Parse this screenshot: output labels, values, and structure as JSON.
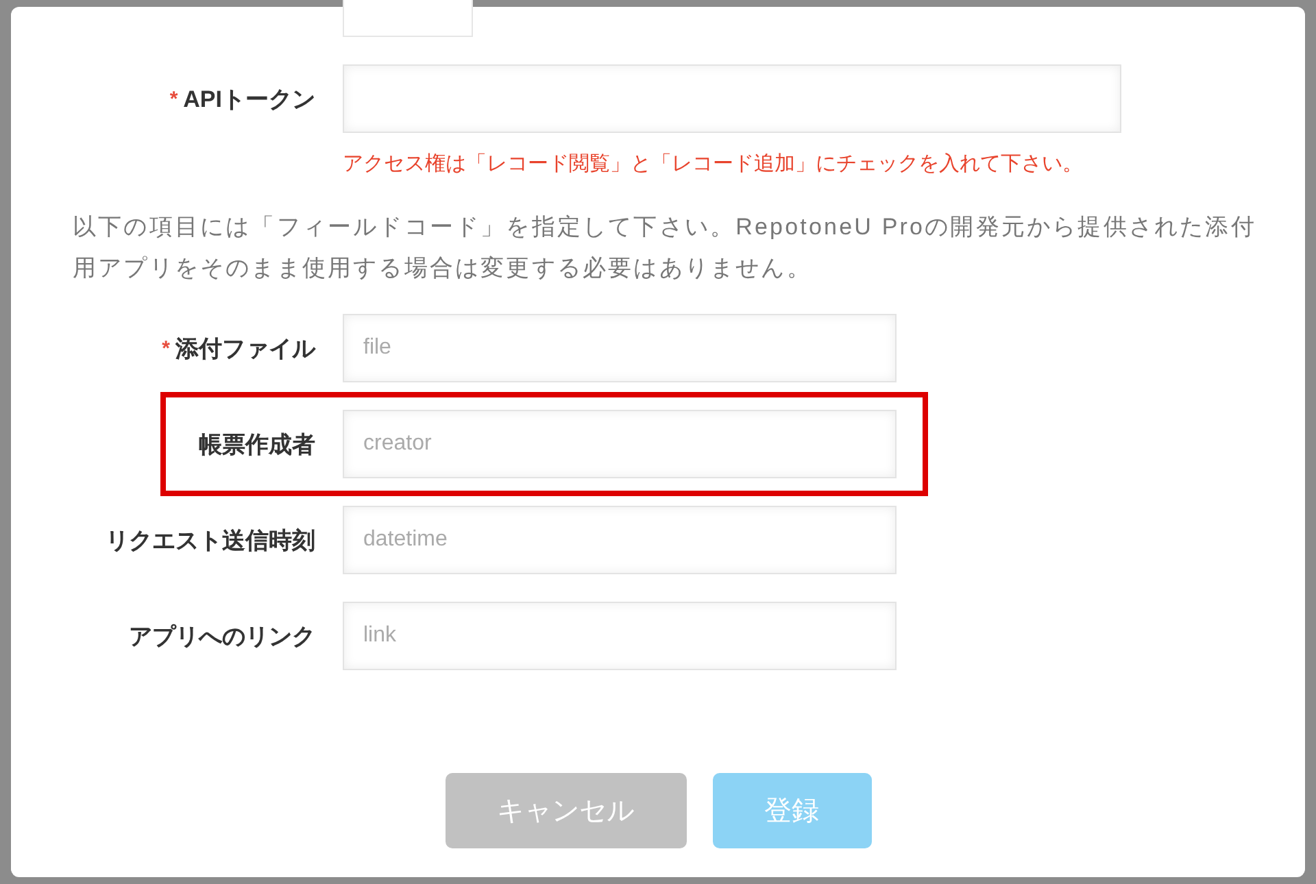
{
  "token_field": {
    "label": "APIトークン",
    "marker": "*",
    "note": "アクセス権は「レコード閲覧」と「レコード追加」にチェックを入れて下さい。"
  },
  "description": "以下の項目には「フィールドコード」を指定して下さい。RepotoneU Proの開発元から提供された添付用アプリをそのまま使用する場合は変更する必要はありません。",
  "code_fields": [
    {
      "label": "添付ファイル",
      "marker": "*",
      "placeholder": "file",
      "highlighted": false
    },
    {
      "label": "帳票作成者",
      "placeholder": "creator",
      "highlighted": true
    },
    {
      "label": "リクエスト送信時刻",
      "placeholder": "datetime",
      "highlighted": false
    },
    {
      "label": "アプリへのリンク",
      "placeholder": "link",
      "highlighted": false
    }
  ],
  "buttons": [
    {
      "label": "キャンセル",
      "kind": "cancel",
      "disabled": false
    },
    {
      "label": "登録",
      "kind": "submit",
      "disabled": true
    }
  ]
}
